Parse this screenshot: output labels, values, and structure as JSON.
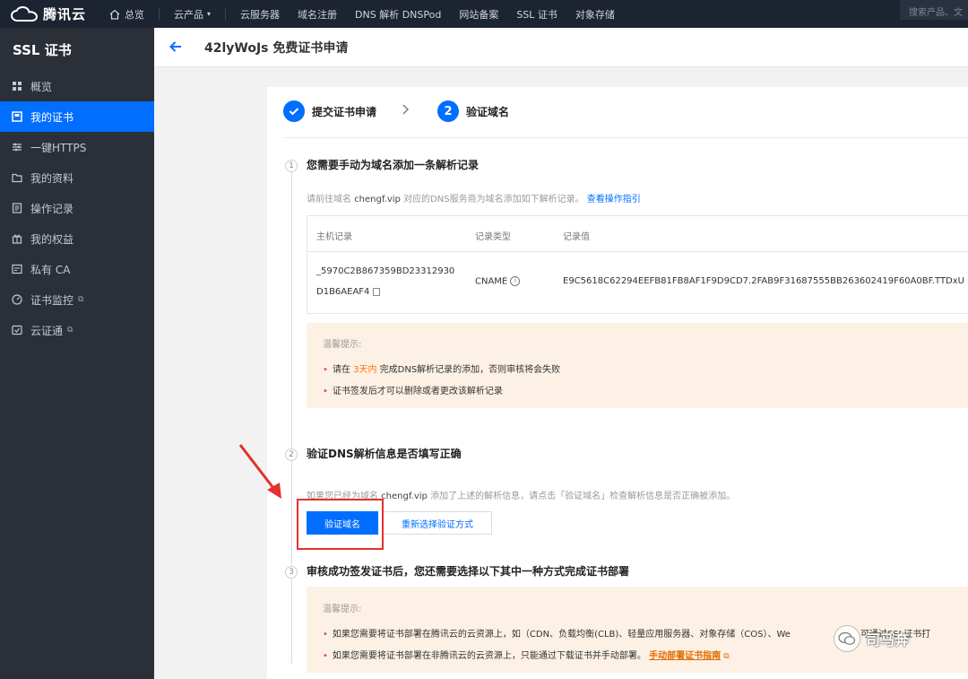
{
  "topbar": {
    "brand": "腾讯云",
    "nav": [
      "总览",
      "云产品",
      "云服务器",
      "域名注册",
      "DNS 解析 DNSPod",
      "网站备案",
      "SSL 证书",
      "对象存储"
    ],
    "search_placeholder": "搜索产品、文"
  },
  "sidebar": {
    "title": "SSL 证书",
    "items": [
      {
        "label": "概览",
        "icon": "grid-icon"
      },
      {
        "label": "我的证书",
        "icon": "certificate-icon"
      },
      {
        "label": "一键HTTPS",
        "icon": "sliders-icon"
      },
      {
        "label": "我的资料",
        "icon": "folder-icon"
      },
      {
        "label": "操作记录",
        "icon": "log-icon"
      },
      {
        "label": "我的权益",
        "icon": "gift-icon"
      },
      {
        "label": "私有 CA",
        "icon": "ca-icon"
      },
      {
        "label": "证书监控",
        "icon": "monitor-icon"
      },
      {
        "label": "云证通",
        "icon": "shield-icon"
      }
    ]
  },
  "header": {
    "title": "42lyWoJs 免费证书申请"
  },
  "steps": [
    {
      "label": "提交证书申请"
    },
    {
      "number": "2",
      "label": "验证域名"
    }
  ],
  "section1": {
    "num": "1",
    "title": "您需要手动为域名添加一条解析记录",
    "desc_prefix": "请前往域名",
    "domain": "chengf.vip",
    "desc_middle": "对应的DNS服务商为域名添加如下解析记录。",
    "link": "查看操作指引",
    "table": {
      "headers": [
        "主机记录",
        "记录类型",
        "记录值"
      ],
      "host_line1": "_5970C2B867359BD23312930",
      "host_line2": "D1B6AEAF4",
      "type": "CNAME",
      "value": "E9C5618C62294EEFB81FB8AF1F9D9CD7.2FAB9F31687555BB263602419F60A0BF.TTDxU"
    },
    "notice": {
      "title": "温馨提示:",
      "b1_pre": "请在",
      "b1_highlight": "3天内",
      "b1_post": "完成DNS解析记录的添加，否则审核将会失败",
      "b2": "证书签发后才可以删除或者更改该解析记录"
    }
  },
  "section2": {
    "num": "2",
    "title": "验证DNS解析信息是否填写正确",
    "desc_prefix": "如果您已经为域名",
    "domain": "chengf.vip",
    "desc_post": "添加了上述的解析信息，请点击「验证域名」检查解析信息是否正确被添加。",
    "btn_verify": "验证域名",
    "btn_reselect": "重新选择验证方式"
  },
  "section3": {
    "num": "3",
    "title": "审核成功签发证书后，您还需要选择以下其中一种方式完成证书部署",
    "notice": {
      "title": "温馨提示:",
      "b1": "如果您需要将证书部署在腾讯云的云资源上，如（CDN、负载均衡(CLB)、轻量应用服务器、对象存储（COS）、We",
      "b1_tail": "可通过SSL证书打",
      "b2": "如果您需要将证书部署在非腾讯云的云资源上，只能通过下载证书并手动部署。",
      "b2_link": "手动部署证书指南"
    }
  },
  "watermark": {
    "text": "司马奔"
  },
  "colors": {
    "primary": "#006eff",
    "topbar": "#1c2331",
    "sidebar": "#2b2f38",
    "notice_bg": "#fdf1e5",
    "highlight_red": "#e4312b"
  }
}
